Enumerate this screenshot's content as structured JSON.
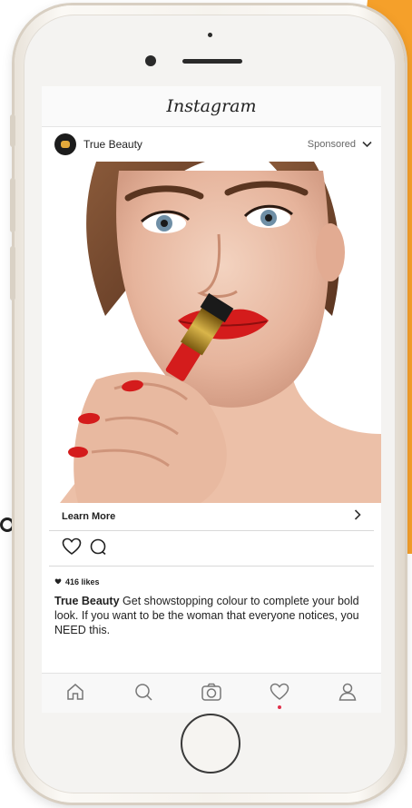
{
  "app": {
    "logo_text": "Instagram"
  },
  "post": {
    "account_name": "True Beauty",
    "sponsored_label": "Sponsored",
    "cta_label": "Learn More",
    "likes_text": "416 likes",
    "caption_author": "True Beauty",
    "caption_text": " Get showstopping colour to complete your bold look. If you want to be the woman that everyone notices, you NEED this."
  },
  "icons": {
    "header_menu": "chevron-down-icon",
    "cta_arrow": "chevron-right-icon",
    "like": "heart-icon",
    "comment": "comment-icon",
    "likes_heart": "heart-filled-icon",
    "nav": [
      "home-icon",
      "search-icon",
      "camera-icon",
      "heart-icon",
      "profile-icon"
    ]
  },
  "colors": {
    "accent_orange": "#f5a02a",
    "lipstick_red": "#d41c1c",
    "notification_dot": "#e0304a"
  }
}
